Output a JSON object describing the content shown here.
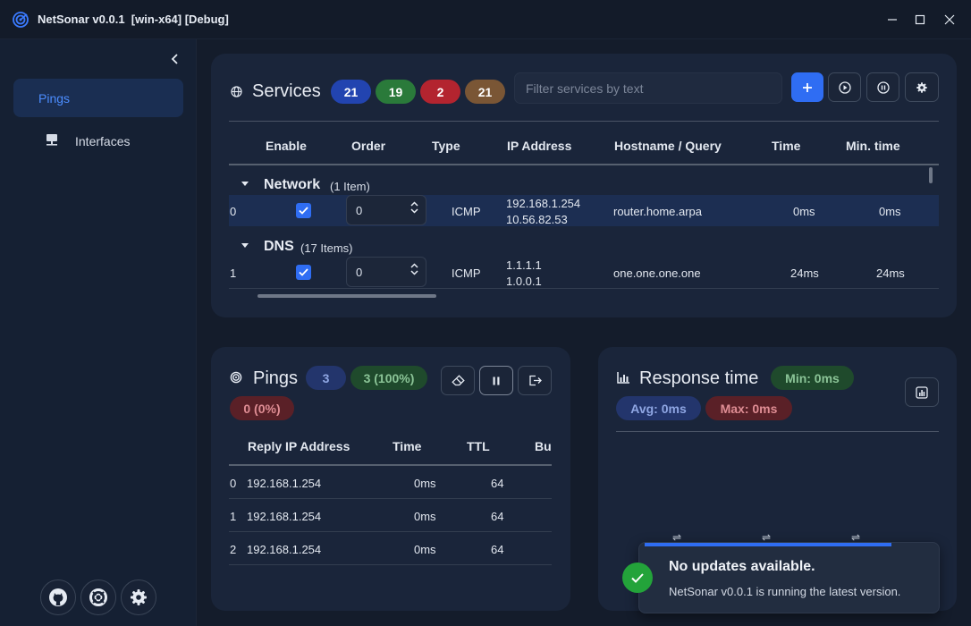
{
  "window": {
    "title": "NetSonar v0.0.1  [win-x64] [Debug]"
  },
  "sidebar": {
    "items": [
      {
        "label": "Pings",
        "active": true
      },
      {
        "label": "Interfaces",
        "active": false
      }
    ]
  },
  "services": {
    "title": "Services",
    "counts": {
      "total": "21",
      "ok": "19",
      "failed": "2",
      "other": "21"
    },
    "filter_placeholder": "Filter services by text",
    "columns": [
      "Enable",
      "Order",
      "Type",
      "IP Address",
      "Hostname / Query",
      "Time",
      "Min. time"
    ],
    "groups": [
      {
        "name": "Network",
        "count_label": "(1 Item)",
        "rows": [
          {
            "index": "0",
            "order": "0",
            "type": "ICMP",
            "ip1": "192.168.1.254",
            "ip2": "10.56.82.53",
            "host": "router.home.arpa",
            "time": "0ms",
            "min": "0ms"
          }
        ]
      },
      {
        "name": "DNS",
        "count_label": "(17 Items)",
        "rows": [
          {
            "index": "1",
            "order": "0",
            "type": "ICMP",
            "ip1": "1.1.1.1",
            "ip2": "1.0.0.1",
            "host": "one.one.one.one",
            "time": "24ms",
            "min": "24ms"
          }
        ]
      }
    ]
  },
  "pings": {
    "title": "Pings",
    "count": "3",
    "success": "3 (100%)",
    "failed": "0 (0%)",
    "columns": [
      "Reply IP Address",
      "Time",
      "TTL",
      "Bu"
    ],
    "rows": [
      {
        "index": "0",
        "ip": "192.168.1.254",
        "time": "0ms",
        "ttl": "64"
      },
      {
        "index": "1",
        "ip": "192.168.1.254",
        "time": "0ms",
        "ttl": "64"
      },
      {
        "index": "2",
        "ip": "192.168.1.254",
        "time": "0ms",
        "ttl": "64"
      }
    ]
  },
  "response": {
    "title": "Response time",
    "min": "Min: 0ms",
    "avg": "Avg: 0ms",
    "max": "Max: 0ms"
  },
  "toast": {
    "title": "No updates available.",
    "message": "NetSonar v0.0.1 is running the latest version."
  },
  "colors": {
    "accent": "#2f6df3",
    "ok": "#2a7a3a",
    "failed": "#b3242f",
    "other": "#7a5635"
  },
  "icons": [
    "radar-icon",
    "minimize-icon",
    "maximize-icon",
    "close-icon",
    "chevron-left-icon",
    "network-icon",
    "github-icon",
    "lifebuoy-icon",
    "gear-icon",
    "globe-icon",
    "plus-icon",
    "play-icon",
    "pause-icon",
    "eraser-icon",
    "export-icon",
    "chart-icon",
    "checkmark-icon"
  ]
}
